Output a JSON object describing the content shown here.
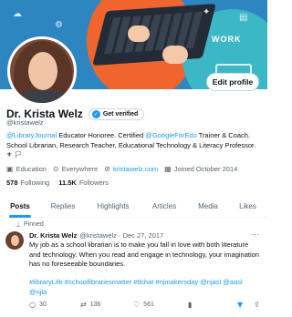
{
  "profile": {
    "name": "Dr. Krista Welz",
    "handle": "@kristawelz",
    "edit_label": "Edit profile",
    "verified_label": "Get verified",
    "bio_link1": "@LibraryJournal",
    "bio_text1": " Educator Honoree. Certified ",
    "bio_link2": "@GoogleForEdu",
    "bio_text2": " Trainer & Coach. School Librarian, Research Teacher, Educational Technology & Literacy Professor.",
    "bio_emoji": "⚜ 🏳",
    "category": "Education",
    "location": "Everywhere",
    "website": "kristawelz.com",
    "joined": "Joined October 2014",
    "following_count": "578",
    "following_label": "Following",
    "followers_count": "11.5K",
    "followers_label": "Followers"
  },
  "tabs": [
    "Posts",
    "Replies",
    "Highlights",
    "Articles",
    "Media",
    "Likes"
  ],
  "tweet": {
    "pinned_label": "Pinned",
    "name": "Dr. Krista Welz",
    "meta": "@kristawelz · Dec 27, 2017",
    "more": "···",
    "body": "My job as a school librarian is to make you fall in love with both literature and technology. When you read and engage in technology, your imagination has no foreseeable boundaries.",
    "tags": "#libraryLife #schoollibrariesmatter #tlchat #njmakersday @njasl @aasl @njla",
    "replies": "30",
    "retweets": "136",
    "likes": "561"
  },
  "icons": {
    "category": "briefcase-icon",
    "location": "location-pin-icon",
    "website": "link-icon",
    "joined": "calendar-icon",
    "verified": "verified-check-icon",
    "pinned": "pin-icon",
    "reply": "reply-icon",
    "retweet": "retweet-icon",
    "like": "heart-icon",
    "views": "views-icon",
    "bookmark": "bookmark-icon",
    "share": "share-icon"
  },
  "colors": {
    "accent": "#1d9bf0",
    "text": "#0f1419",
    "muted": "#536471"
  }
}
